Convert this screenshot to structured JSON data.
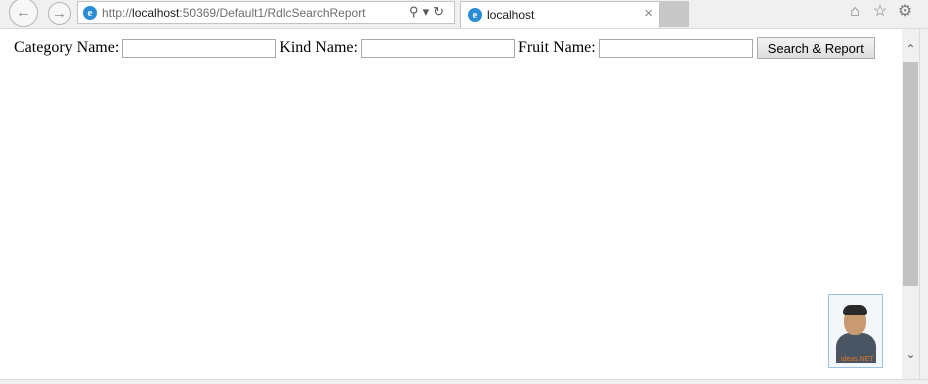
{
  "browser": {
    "url_prefix": "http://",
    "url_host": "localhost",
    "url_rest": ":50369/Default1/RdlcSearchReport",
    "tab_title": "localhost",
    "icons": {
      "back": "back-arrow-icon",
      "forward": "forward-arrow-icon",
      "search": "search-icon",
      "refresh": "refresh-icon",
      "close": "close-icon",
      "home": "home-icon",
      "favorites": "star-icon",
      "settings": "gear-icon"
    }
  },
  "form": {
    "category_label": "Category Name:",
    "category_value": "",
    "kind_label": "Kind Name:",
    "kind_value": "",
    "fruit_label": "Fruit Name:",
    "fruit_value": "",
    "search_button": "Search & Report"
  },
  "avatar_badge": {
    "text": "ideas.NET"
  }
}
